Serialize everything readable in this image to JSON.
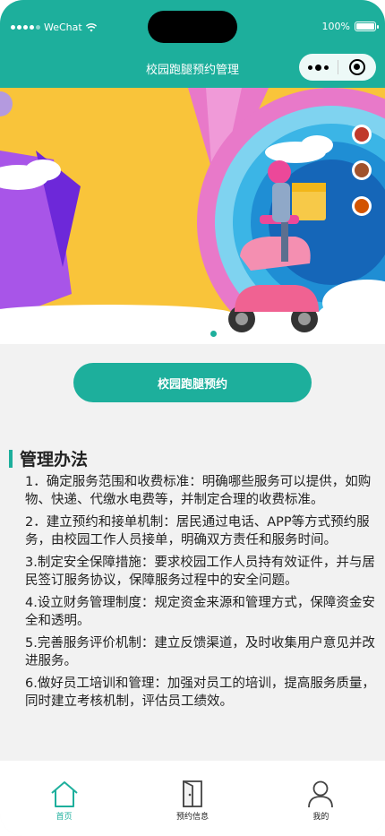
{
  "status_bar": {
    "carrier": "WeChat",
    "battery": "100%"
  },
  "nav": {
    "title": "校园跑腿预约管理"
  },
  "banner": {
    "slide_count": 1,
    "active_slide": 1
  },
  "book_button": {
    "label": "校园跑腿预约"
  },
  "management": {
    "title": "管理办法",
    "rules": [
      "1．确定服务范围和收费标准：明确哪些服务可以提供，如购物、快递、代缴水电费等，并制定合理的收费标准。",
      "2．建立预约和接单机制：居民通过电话、APP等方式预约服务，由校园工作人员接单，明确双方责任和服务时间。",
      "3.制定安全保障措施：要求校园工作人员持有效证件，并与居民签订服务协议，保障服务过程中的安全问题。",
      "4.设立财务管理制度：规定资金来源和管理方式，保障资金安全和透明。",
      "5.完善服务评价机制：建立反馈渠道，及时收集用户意见并改进服务。",
      "6.做好员工培训和管理：加强对员工的培训，提高服务质量，同时建立考核机制，评估员工绩效。"
    ]
  },
  "tabbar": {
    "items": [
      {
        "label": "首页",
        "icon": "home-icon",
        "active": true
      },
      {
        "label": "预约信息",
        "icon": "door-icon",
        "active": false
      },
      {
        "label": "我的",
        "icon": "user-icon",
        "active": false
      }
    ]
  },
  "colors": {
    "accent": "#1daf9c",
    "banner_yellow": "#f9c43a",
    "banner_purple": "#a855e8",
    "banner_pink": "#e879c9",
    "banner_blue": "#29a7de"
  }
}
